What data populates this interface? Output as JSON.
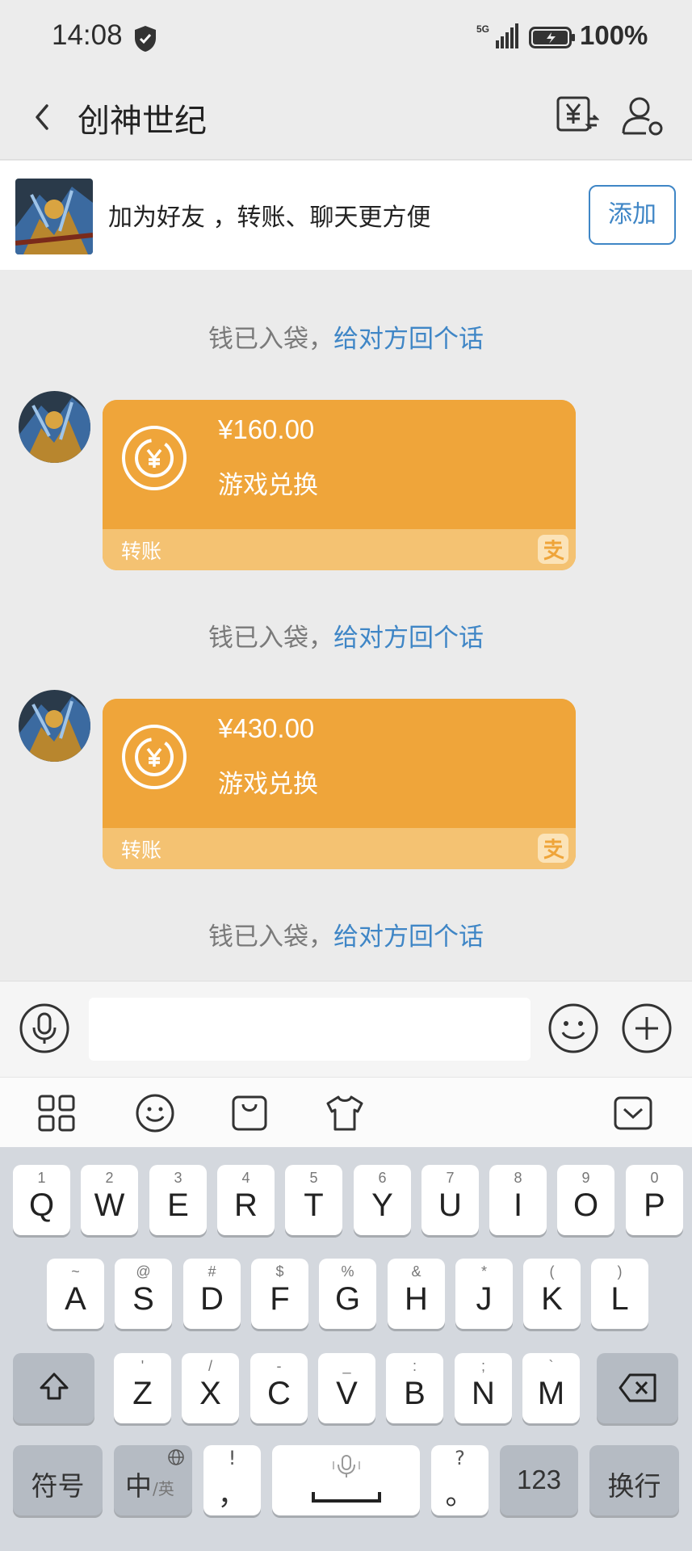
{
  "status_bar": {
    "time": "14:08",
    "network": "5G",
    "battery": "100%"
  },
  "header": {
    "title": "创神世纪"
  },
  "add_friend": {
    "text": "加为好友 ，转账、聊天更方便",
    "button": "添加"
  },
  "notices": [
    {
      "grey": "钱已入袋，",
      "link": "给对方回个话"
    },
    {
      "grey": "钱已入袋，",
      "link": "给对方回个话"
    },
    {
      "grey": "钱已入袋，",
      "link": "给对方回个话"
    }
  ],
  "messages": [
    {
      "amount": "¥160.00",
      "desc": "游戏兑换",
      "type": "转账"
    },
    {
      "amount": "¥430.00",
      "desc": "游戏兑换",
      "type": "转账"
    }
  ],
  "keyboard": {
    "row1": [
      {
        "k": "Q",
        "s": "1"
      },
      {
        "k": "W",
        "s": "2"
      },
      {
        "k": "E",
        "s": "3"
      },
      {
        "k": "R",
        "s": "4"
      },
      {
        "k": "T",
        "s": "5"
      },
      {
        "k": "Y",
        "s": "6"
      },
      {
        "k": "U",
        "s": "7"
      },
      {
        "k": "I",
        "s": "8"
      },
      {
        "k": "O",
        "s": "9"
      },
      {
        "k": "P",
        "s": "0"
      }
    ],
    "row2": [
      {
        "k": "A",
        "s": "~"
      },
      {
        "k": "S",
        "s": "@"
      },
      {
        "k": "D",
        "s": "#"
      },
      {
        "k": "F",
        "s": "$"
      },
      {
        "k": "G",
        "s": "%"
      },
      {
        "k": "H",
        "s": "&"
      },
      {
        "k": "J",
        "s": "*"
      },
      {
        "k": "K",
        "s": "("
      },
      {
        "k": "L",
        "s": ")"
      }
    ],
    "row3": [
      {
        "k": "Z",
        "s": "'"
      },
      {
        "k": "X",
        "s": "/"
      },
      {
        "k": "C",
        "s": "-"
      },
      {
        "k": "V",
        "s": "_"
      },
      {
        "k": "B",
        "s": ":"
      },
      {
        "k": "N",
        "s": ";"
      },
      {
        "k": "M",
        "s": "`"
      }
    ],
    "symbols": "符号",
    "lang_main": "中",
    "lang_sub": "/英",
    "comma_sup": "!",
    "comma": "，",
    "period_sup": "?",
    "period": "。",
    "num": "123",
    "enter": "换行"
  },
  "colors": {
    "accent_blue": "#3f86c6",
    "card_orange": "#efa53a",
    "card_footer": "#f4c272"
  }
}
